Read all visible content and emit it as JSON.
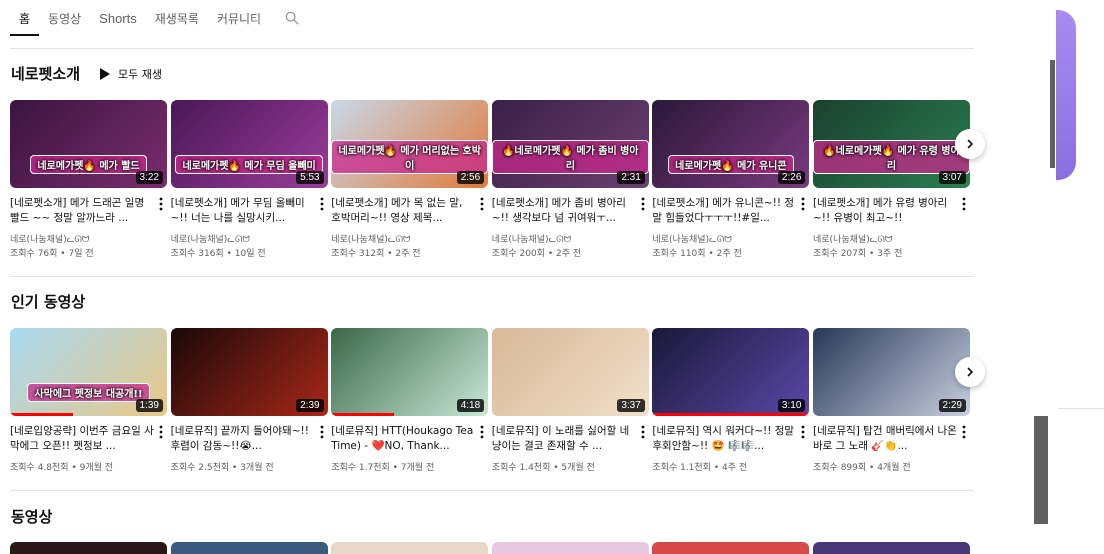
{
  "tabs": [
    {
      "label": "홈",
      "active": true
    },
    {
      "label": "동영상",
      "active": false
    },
    {
      "label": "Shorts",
      "active": false
    },
    {
      "label": "재생목록",
      "active": false
    },
    {
      "label": "커뮤니티",
      "active": false
    }
  ],
  "search_icon": "search-icon",
  "sections": {
    "s1": {
      "title": "네로펫소개",
      "play_all": "모두 재생",
      "videos": [
        {
          "title": "[네로펫소개] 메가 드래곤 일명 빨드 ~~ 정말 알까느라 ...",
          "channel": "네로(나눔채널)ᓚᘏᗢ",
          "views": "조회수 76회",
          "age": "7일 전",
          "duration": "3:22",
          "thumb_text": "네로메가펫🔥 메가 빨드",
          "c1": "#3a1440",
          "c2": "#7a2d6e"
        },
        {
          "title": "[네로펫소개] 메가 무딤 올빼미~!! 너는 나를 실망시키...",
          "channel": "네로(나눔채널)ᓚᘏᗢ",
          "views": "조회수 316회",
          "age": "10일 전",
          "duration": "5:53",
          "thumb_text": "네로메가펫🔥 메가 무딤 올빼미",
          "c1": "#4a1858",
          "c2": "#9a3c9a"
        },
        {
          "title": "[네로펫소개] 메가 목 없는 말, 호박머리~!! 영상 제목...",
          "channel": "네로(나눔채널)ᓚᘏᗢ",
          "views": "조회수 312회",
          "age": "2주 전",
          "duration": "2:56",
          "thumb_text": "네로메가펫🔥 메가 머리없는 호박이",
          "c1": "#c8d8e8",
          "c2": "#e07a3a"
        },
        {
          "title": "[네로펫소개] 메가 좀비 병아리~!! 생각보다 넘 귀여워ㅜ...",
          "channel": "네로(나눔채널)ᓚᘏᗢ",
          "views": "조회수 200회",
          "age": "2주 전",
          "duration": "2:31",
          "thumb_text": "🔥네로메가펫🔥 메가 좀비 병아리",
          "c1": "#3a2048",
          "c2": "#6a4070"
        },
        {
          "title": "[네로펫소개] 메가 유니콘~!! 정말 힘들었다ㅜㅜㅜ!!#일...",
          "channel": "네로(나눔채널)ᓚᘏᗢ",
          "views": "조회수 110회",
          "age": "2주 전",
          "duration": "2:26",
          "thumb_text": "네로메가펫🔥 메가 유니콘",
          "c1": "#2a1838",
          "c2": "#7a3a80"
        },
        {
          "title": "[네로펫소개] 메가 유령 병아리~!! 유병이 최고~!!",
          "channel": "네로(나눔채널)ᓚᘏᗢ",
          "views": "조회수 207회",
          "age": "3주 전",
          "duration": "3:07",
          "thumb_text": "🔥네로메가펫🔥 메가 유령 병아리",
          "c1": "#1a4030",
          "c2": "#2a8050"
        }
      ]
    },
    "s2": {
      "title": "인기 동영상",
      "videos": [
        {
          "title": "[네로입양공략] 이번주 금요일 사막에그 오픈!! 펫정보 ...",
          "channel": "",
          "views": "조회수 4.8천회",
          "age": "9개월 전",
          "duration": "1:39",
          "thumb_text": "사막에그 펫정보 대공개!!",
          "c1": "#a8d8f0",
          "c2": "#e8c888"
        },
        {
          "title": "[네로뮤직] 끝까지 들어야돼~!! 후렴이 감동~!!😭...",
          "channel": "",
          "views": "조회수 2.5천회",
          "age": "3개월 전",
          "duration": "2:39",
          "thumb_text": "",
          "c1": "#1a0808",
          "c2": "#a82818"
        },
        {
          "title": "[네로뮤직] HTT(Houkago Tea Time) - ❤️NO, Thank...",
          "channel": "",
          "views": "조회수 1.7천회",
          "age": "7개월 전",
          "duration": "4:18",
          "thumb_text": "",
          "c1": "#3a6848",
          "c2": "#c8e8d8"
        },
        {
          "title": "[네로뮤직] 이 노래를 싫어할 네냥이는 결코 존재할 수 ...",
          "channel": "",
          "views": "조회수 1.4천회",
          "age": "5개월 전",
          "duration": "3:37",
          "thumb_text": "",
          "c1": "#d8b898",
          "c2": "#f0e0c8"
        },
        {
          "title": "[네로뮤직] 역시 워커다~!! 정말 후회안함~!! 🤩 🎼🎼...",
          "channel": "",
          "views": "조회수 1.1천회",
          "age": "4주 전",
          "duration": "3:10",
          "thumb_text": "",
          "c1": "#1a1838",
          "c2": "#5a48a8"
        },
        {
          "title": "[네로뮤직] 탑건 매버릭에서 나온 바로 그 노래 🎸👏...",
          "channel": "",
          "views": "조회수 899회",
          "age": "4개월 전",
          "duration": "2:29",
          "thumb_text": "",
          "c1": "#283858",
          "c2": "#c8d0e0"
        }
      ]
    },
    "s3": {
      "title": "동영상",
      "peeks": [
        {
          "c": "#2a1818"
        },
        {
          "c": "#3a5a80"
        },
        {
          "c": "#e8d8c8"
        },
        {
          "c": "#e8c8e0"
        },
        {
          "c": "#d84848"
        },
        {
          "c": "#483878"
        }
      ]
    }
  },
  "icons": {
    "play": "play-icon",
    "kebab": "more-vert-icon",
    "next": "chevron-right-icon"
  },
  "colors": {
    "accent_red": "#ff0000",
    "text_primary": "#0f0f0f",
    "text_secondary": "#606060"
  }
}
